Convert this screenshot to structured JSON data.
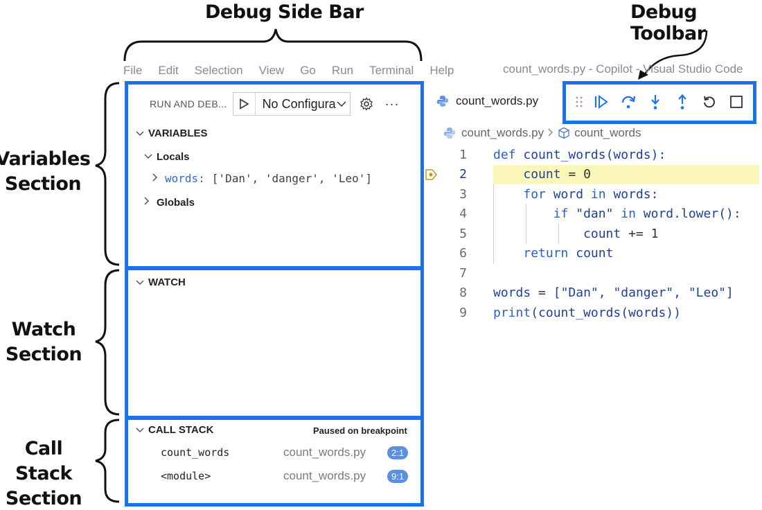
{
  "annotations": {
    "debug_side_bar": "Debug Side Bar",
    "debug_toolbar": "Debug Toolbar",
    "variables_section": [
      "Variables",
      "Section"
    ],
    "watch_section": [
      "Watch",
      "Section"
    ],
    "call_stack_section": [
      "Call Stack",
      "Section"
    ]
  },
  "menu": {
    "items": [
      "File",
      "Edit",
      "Selection",
      "View",
      "Go",
      "Run",
      "Terminal",
      "Help"
    ],
    "window_title": "count_words.py - Copilot - Visual Studio Code"
  },
  "sidebar": {
    "title": "RUN AND DEB...",
    "config": "No Configurations",
    "more": "···",
    "variables": {
      "header": "VARIABLES",
      "locals_label": "Locals",
      "local_var_name": "words:",
      "local_var_value": "['Dan', 'danger', 'Leo']",
      "globals_label": "Globals"
    },
    "watch": {
      "header": "WATCH"
    },
    "call_stack": {
      "header": "CALL STACK",
      "status": "Paused on breakpoint",
      "frames": [
        {
          "name": "count_words",
          "file": "count_words.py",
          "position": "2:1"
        },
        {
          "name": "<module>",
          "file": "count_words.py",
          "position": "9:1"
        }
      ]
    }
  },
  "editor": {
    "tab_label": "count_words.py",
    "breadcrumb": [
      "count_words.py",
      "count_words"
    ],
    "current_line": 2,
    "lines": [
      {
        "num": "1",
        "text": "def count_words(words):"
      },
      {
        "num": "2",
        "text": "    count = 0"
      },
      {
        "num": "3",
        "text": "    for word in words:"
      },
      {
        "num": "4",
        "text": "        if \"dan\" in word.lower():"
      },
      {
        "num": "5",
        "text": "            count += 1"
      },
      {
        "num": "6",
        "text": "    return count"
      },
      {
        "num": "7",
        "text": ""
      },
      {
        "num": "8",
        "text": "words = [\"Dan\", \"danger\", \"Leo\"]"
      },
      {
        "num": "9",
        "text": "print(count_words(words))"
      }
    ]
  },
  "toolbar": {
    "buttons": [
      "drag-handle",
      "continue",
      "step-over",
      "step-into",
      "step-out",
      "restart",
      "stop"
    ]
  },
  "colors": {
    "highlight_box": "#1a73e8",
    "current_line_bg": "#fbf7b8",
    "badge": "#5b8fe0",
    "keyword": "#2a5fd0"
  }
}
